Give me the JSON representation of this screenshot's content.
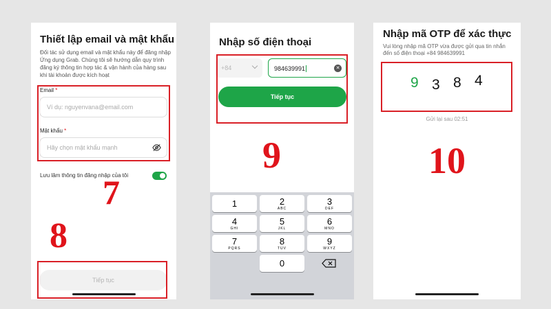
{
  "screen1": {
    "title": "Thiết lập email và mật khẩu",
    "description": "Đối tác sử dụng email và mật khẩu này để đăng nhập Ứng dụng Grab. Chúng tôi sẽ hướng dẫn quy trình đăng ký thông tin hợp tác & vận hành của hàng sau khi tài khoản được kích hoạt",
    "email_label": "Email",
    "email_placeholder": "Ví dụ: nguyenvana@email.com",
    "password_label": "Mật khẩu",
    "password_placeholder": "Hãy chọn mật khẩu mạnh",
    "required_mark": "*",
    "save_login_label": "Lưu lâm thông tin đăng nhập của tôi",
    "save_login_enabled": true,
    "continue_label": "Tiếp tục",
    "step_numbers": [
      "7",
      "8"
    ]
  },
  "screen2": {
    "title": "Nhập số điện thoại",
    "country_code": "+84",
    "phone_value": "984639991",
    "continue_label": "Tiếp tục",
    "step_number": "9",
    "keypad": [
      {
        "digit": "1",
        "letters": ""
      },
      {
        "digit": "2",
        "letters": "ABC"
      },
      {
        "digit": "3",
        "letters": "DEF"
      },
      {
        "digit": "4",
        "letters": "GHI"
      },
      {
        "digit": "5",
        "letters": "JKL"
      },
      {
        "digit": "6",
        "letters": "MNO"
      },
      {
        "digit": "7",
        "letters": "PQRS"
      },
      {
        "digit": "8",
        "letters": "TUV"
      },
      {
        "digit": "9",
        "letters": "WXYZ"
      },
      {
        "digit": "0",
        "letters": ""
      }
    ]
  },
  "screen3": {
    "title": "Nhập mã OTP để xác thực",
    "description": "Vui lòng nhập mã OTP vừa được gửi qua tin nhắn đến số điện thoại +84 984639991",
    "otp_digits": [
      "9",
      "3",
      "8",
      "4"
    ],
    "resend_label": "Gửi lại sau 02:51",
    "step_number": "10"
  },
  "colors": {
    "accent_green": "#1ea548",
    "annotation_red": "#e0141b",
    "background": "#e6e6e6"
  },
  "icons": [
    "chevron-down-icon",
    "clear-icon",
    "eye-off-icon",
    "backspace-icon"
  ]
}
